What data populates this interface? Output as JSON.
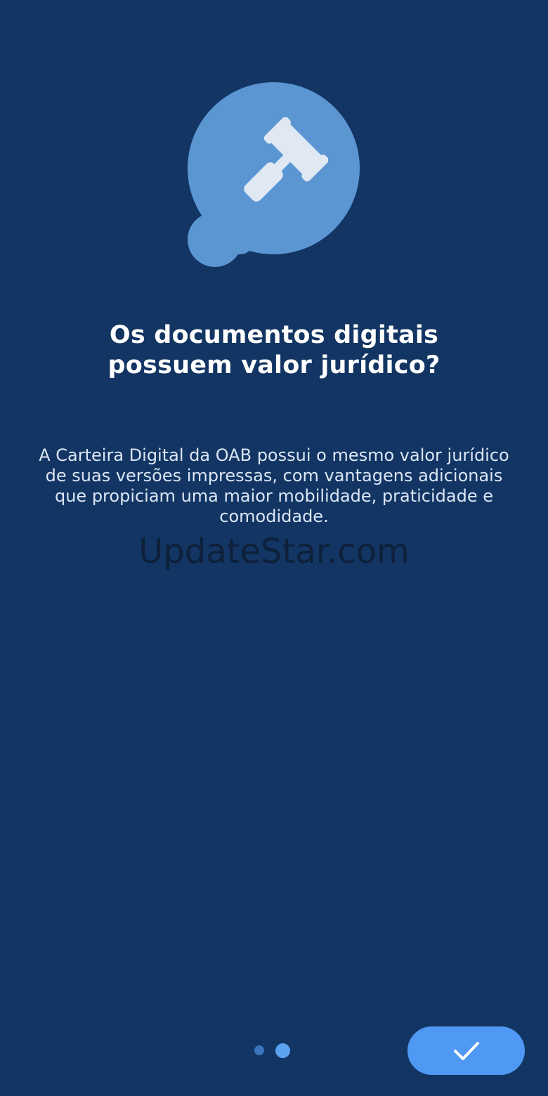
{
  "onboarding": {
    "title": "Os documentos digitais\npossuem valor jurídico?",
    "description": "A Carteira Digital da OAB possui o mesmo valor jurídico de suas versões impressas, com vantagens adicionais que propiciam uma maior mobilidade, praticidade e comodidade.",
    "illustration_icon": "gavel-icon",
    "watermark": "UpdateStar.com"
  },
  "pagination": {
    "total": 2,
    "current": 2
  },
  "confirm_button": {
    "icon": "check-icon"
  },
  "colors": {
    "background": "#123563",
    "bubble": "#5b96d3",
    "gavel": "#dfe8f3",
    "button": "#4f98f3",
    "dot_active": "#5aa3f2",
    "dot_inactive": "#3a74bd"
  }
}
